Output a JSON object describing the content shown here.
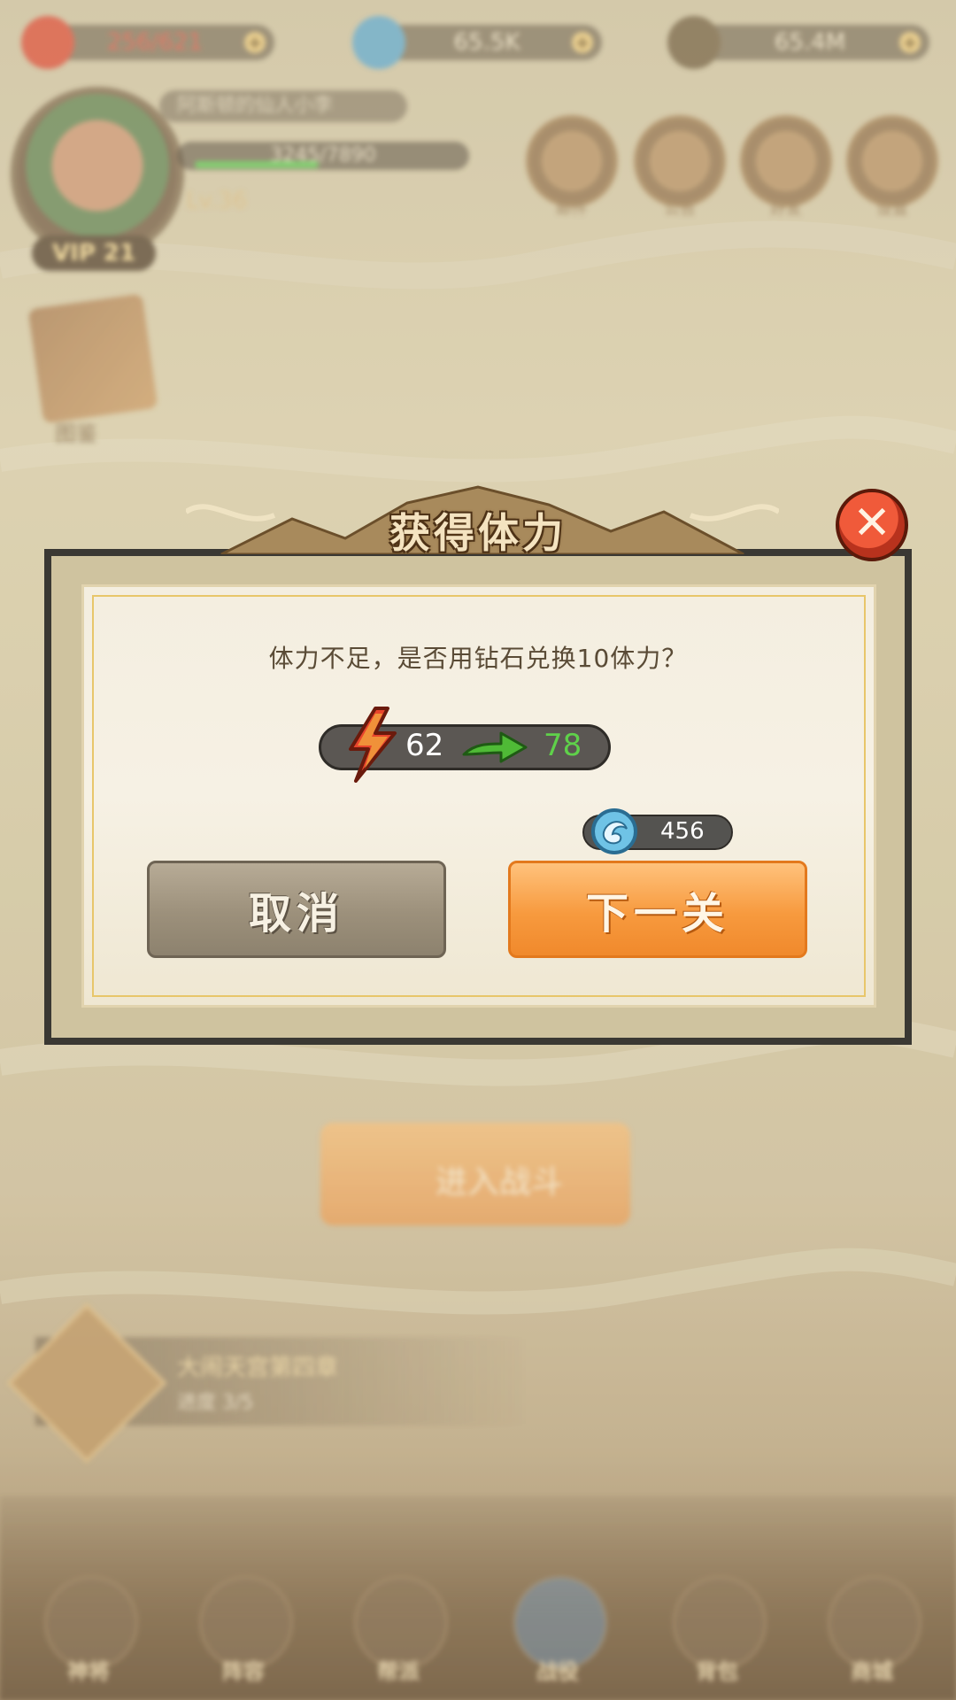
{
  "hud": {
    "stamina": "256/621",
    "diamonds": "65.5K",
    "gold": "65.4M",
    "player_name": "阿斯顿的仙人小李",
    "exp": "3245/7890",
    "level": "Lv.36",
    "vip": "VIP 21"
  },
  "top_menu": [
    {
      "label": "邮件"
    },
    {
      "label": "公告"
    },
    {
      "label": "好友"
    },
    {
      "label": "设置"
    }
  ],
  "book_label": "图鉴",
  "battle_button": "进入战斗",
  "quest": {
    "title": "大闹天宫第四章",
    "progress": "进度 3/5"
  },
  "bottom_nav": [
    {
      "label": "神将"
    },
    {
      "label": "阵容"
    },
    {
      "label": "帮派"
    },
    {
      "label": "战役"
    },
    {
      "label": "背包"
    },
    {
      "label": "商城"
    }
  ],
  "dialog": {
    "title": "获得体力",
    "prompt": "体力不足，是否用钻石兑换10体力？",
    "stamina_from": "62",
    "stamina_to": "78",
    "cost": "456",
    "cancel_label": "取消",
    "confirm_label": "下一关"
  },
  "colors": {
    "confirm": "#f79a3e",
    "cancel": "#9c907b",
    "close": "#e94d2e",
    "stamina_to": "#5fd14a"
  },
  "icons": [
    "lightning-icon",
    "arrow-right-icon",
    "diamond-icon",
    "close-icon",
    "plus-icon"
  ]
}
